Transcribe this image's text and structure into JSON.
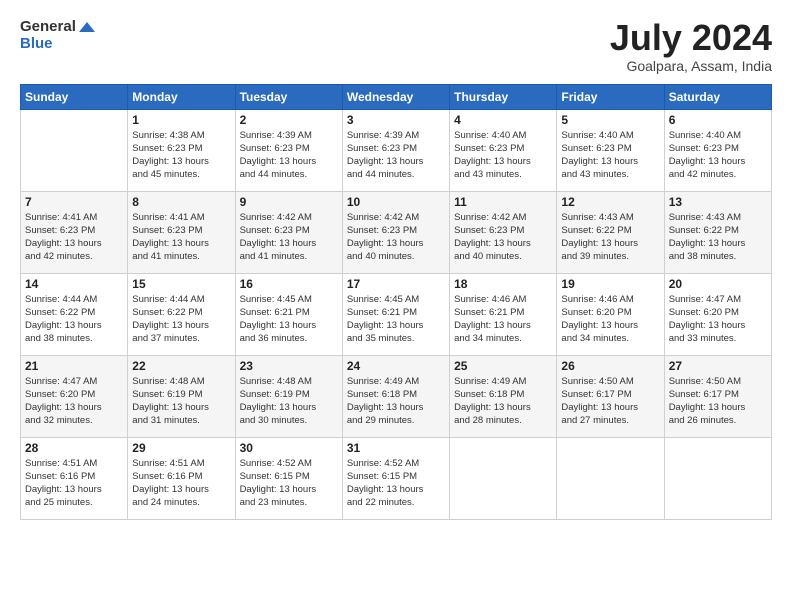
{
  "header": {
    "logo_general": "General",
    "logo_blue": "Blue",
    "month_title": "July 2024",
    "location": "Goalpara, Assam, India"
  },
  "days_of_week": [
    "Sunday",
    "Monday",
    "Tuesday",
    "Wednesday",
    "Thursday",
    "Friday",
    "Saturday"
  ],
  "weeks": [
    [
      {
        "day": "",
        "info": ""
      },
      {
        "day": "1",
        "info": "Sunrise: 4:38 AM\nSunset: 6:23 PM\nDaylight: 13 hours\nand 45 minutes."
      },
      {
        "day": "2",
        "info": "Sunrise: 4:39 AM\nSunset: 6:23 PM\nDaylight: 13 hours\nand 44 minutes."
      },
      {
        "day": "3",
        "info": "Sunrise: 4:39 AM\nSunset: 6:23 PM\nDaylight: 13 hours\nand 44 minutes."
      },
      {
        "day": "4",
        "info": "Sunrise: 4:40 AM\nSunset: 6:23 PM\nDaylight: 13 hours\nand 43 minutes."
      },
      {
        "day": "5",
        "info": "Sunrise: 4:40 AM\nSunset: 6:23 PM\nDaylight: 13 hours\nand 43 minutes."
      },
      {
        "day": "6",
        "info": "Sunrise: 4:40 AM\nSunset: 6:23 PM\nDaylight: 13 hours\nand 42 minutes."
      }
    ],
    [
      {
        "day": "7",
        "info": "Sunrise: 4:41 AM\nSunset: 6:23 PM\nDaylight: 13 hours\nand 42 minutes."
      },
      {
        "day": "8",
        "info": "Sunrise: 4:41 AM\nSunset: 6:23 PM\nDaylight: 13 hours\nand 41 minutes."
      },
      {
        "day": "9",
        "info": "Sunrise: 4:42 AM\nSunset: 6:23 PM\nDaylight: 13 hours\nand 41 minutes."
      },
      {
        "day": "10",
        "info": "Sunrise: 4:42 AM\nSunset: 6:23 PM\nDaylight: 13 hours\nand 40 minutes."
      },
      {
        "day": "11",
        "info": "Sunrise: 4:42 AM\nSunset: 6:23 PM\nDaylight: 13 hours\nand 40 minutes."
      },
      {
        "day": "12",
        "info": "Sunrise: 4:43 AM\nSunset: 6:22 PM\nDaylight: 13 hours\nand 39 minutes."
      },
      {
        "day": "13",
        "info": "Sunrise: 4:43 AM\nSunset: 6:22 PM\nDaylight: 13 hours\nand 38 minutes."
      }
    ],
    [
      {
        "day": "14",
        "info": "Sunrise: 4:44 AM\nSunset: 6:22 PM\nDaylight: 13 hours\nand 38 minutes."
      },
      {
        "day": "15",
        "info": "Sunrise: 4:44 AM\nSunset: 6:22 PM\nDaylight: 13 hours\nand 37 minutes."
      },
      {
        "day": "16",
        "info": "Sunrise: 4:45 AM\nSunset: 6:21 PM\nDaylight: 13 hours\nand 36 minutes."
      },
      {
        "day": "17",
        "info": "Sunrise: 4:45 AM\nSunset: 6:21 PM\nDaylight: 13 hours\nand 35 minutes."
      },
      {
        "day": "18",
        "info": "Sunrise: 4:46 AM\nSunset: 6:21 PM\nDaylight: 13 hours\nand 34 minutes."
      },
      {
        "day": "19",
        "info": "Sunrise: 4:46 AM\nSunset: 6:20 PM\nDaylight: 13 hours\nand 34 minutes."
      },
      {
        "day": "20",
        "info": "Sunrise: 4:47 AM\nSunset: 6:20 PM\nDaylight: 13 hours\nand 33 minutes."
      }
    ],
    [
      {
        "day": "21",
        "info": "Sunrise: 4:47 AM\nSunset: 6:20 PM\nDaylight: 13 hours\nand 32 minutes."
      },
      {
        "day": "22",
        "info": "Sunrise: 4:48 AM\nSunset: 6:19 PM\nDaylight: 13 hours\nand 31 minutes."
      },
      {
        "day": "23",
        "info": "Sunrise: 4:48 AM\nSunset: 6:19 PM\nDaylight: 13 hours\nand 30 minutes."
      },
      {
        "day": "24",
        "info": "Sunrise: 4:49 AM\nSunset: 6:18 PM\nDaylight: 13 hours\nand 29 minutes."
      },
      {
        "day": "25",
        "info": "Sunrise: 4:49 AM\nSunset: 6:18 PM\nDaylight: 13 hours\nand 28 minutes."
      },
      {
        "day": "26",
        "info": "Sunrise: 4:50 AM\nSunset: 6:17 PM\nDaylight: 13 hours\nand 27 minutes."
      },
      {
        "day": "27",
        "info": "Sunrise: 4:50 AM\nSunset: 6:17 PM\nDaylight: 13 hours\nand 26 minutes."
      }
    ],
    [
      {
        "day": "28",
        "info": "Sunrise: 4:51 AM\nSunset: 6:16 PM\nDaylight: 13 hours\nand 25 minutes."
      },
      {
        "day": "29",
        "info": "Sunrise: 4:51 AM\nSunset: 6:16 PM\nDaylight: 13 hours\nand 24 minutes."
      },
      {
        "day": "30",
        "info": "Sunrise: 4:52 AM\nSunset: 6:15 PM\nDaylight: 13 hours\nand 23 minutes."
      },
      {
        "day": "31",
        "info": "Sunrise: 4:52 AM\nSunset: 6:15 PM\nDaylight: 13 hours\nand 22 minutes."
      },
      {
        "day": "",
        "info": ""
      },
      {
        "day": "",
        "info": ""
      },
      {
        "day": "",
        "info": ""
      }
    ]
  ]
}
